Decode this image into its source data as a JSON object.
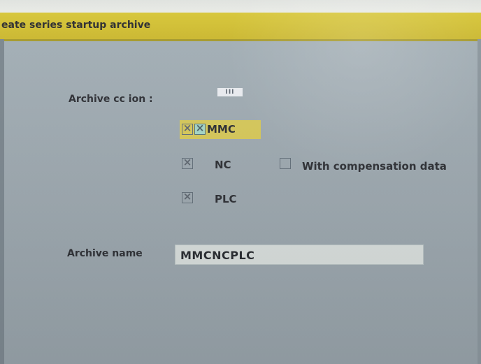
{
  "window": {
    "title": "eate series startup archive"
  },
  "archive_options": {
    "label": "Archive cc ion :",
    "status_chip": "III"
  },
  "options": [
    {
      "label": "MMC",
      "checked": true
    },
    {
      "label": "NC",
      "checked": true
    },
    {
      "label": "With compensation data",
      "checked": false
    },
    {
      "label": "PLC",
      "checked": true
    }
  ],
  "archive_name": {
    "label": "Archive name",
    "value": "MMCNCPLC"
  },
  "icons": {
    "checked_checkbox": "checked-checkbox-icon",
    "unchecked_checkbox": "unchecked-checkbox-icon"
  },
  "colors": {
    "title_bar": "#d7c637",
    "background": "#9ea9b0",
    "highlight": "#d6c85b",
    "active_checkbox": "#a5d6c7",
    "name_field": "#d6dcda"
  }
}
